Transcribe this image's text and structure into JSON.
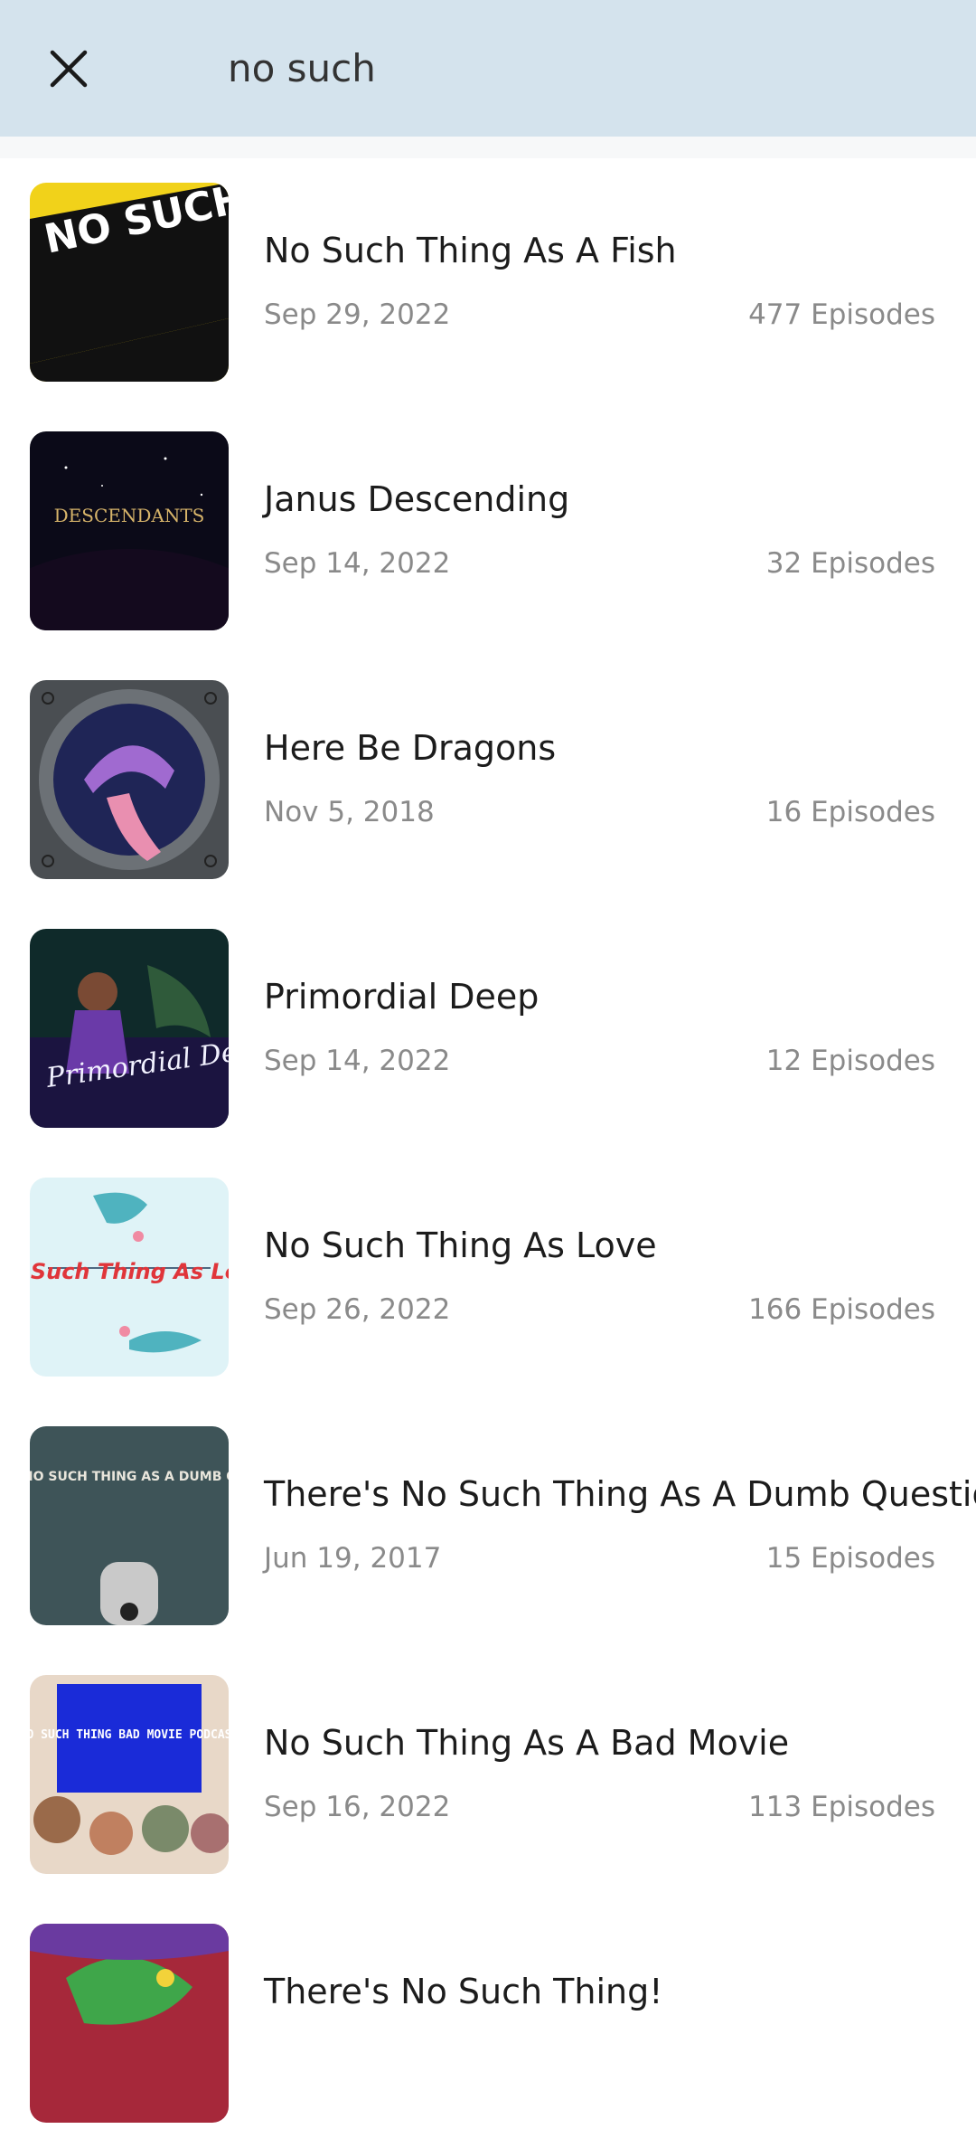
{
  "search": {
    "query": "no such"
  },
  "results": [
    {
      "title": "No Such Thing As A Fish",
      "date": "Sep 29, 2022",
      "episodes": "477 Episodes",
      "artwork": "NO SUCH THING AS A FISH"
    },
    {
      "title": "Janus Descending",
      "date": "Sep 14, 2022",
      "episodes": "32 Episodes",
      "artwork": "DESCENDANTS"
    },
    {
      "title": "Here Be Dragons",
      "date": "Nov 5, 2018",
      "episodes": "16 Episodes",
      "artwork": ""
    },
    {
      "title": "Primordial Deep",
      "date": "Sep 14, 2022",
      "episodes": "12 Episodes",
      "artwork": "Primordial Deep"
    },
    {
      "title": "No Such Thing As Love",
      "date": "Sep 26, 2022",
      "episodes": "166 Episodes",
      "artwork": "No Such Thing As Love"
    },
    {
      "title": "There's No Such Thing As A Dumb Question",
      "date": "Jun 19, 2017",
      "episodes": "15 Episodes",
      "artwork": "THERE'S NO SUCH THING AS A DUMB QUESTION"
    },
    {
      "title": "No Such Thing As A Bad Movie",
      "date": "Sep 16, 2022",
      "episodes": "113 Episodes",
      "artwork": "NO SUCH THING BAD MOVIE PODCAST"
    },
    {
      "title": "There's No Such Thing!",
      "date": "",
      "episodes": "",
      "artwork": ""
    }
  ],
  "colors": {
    "header_bg": "#d4e3ed",
    "title_text": "#1c1c1c",
    "meta_text": "#8a8a8a"
  },
  "icons": {
    "close": "close-icon"
  }
}
